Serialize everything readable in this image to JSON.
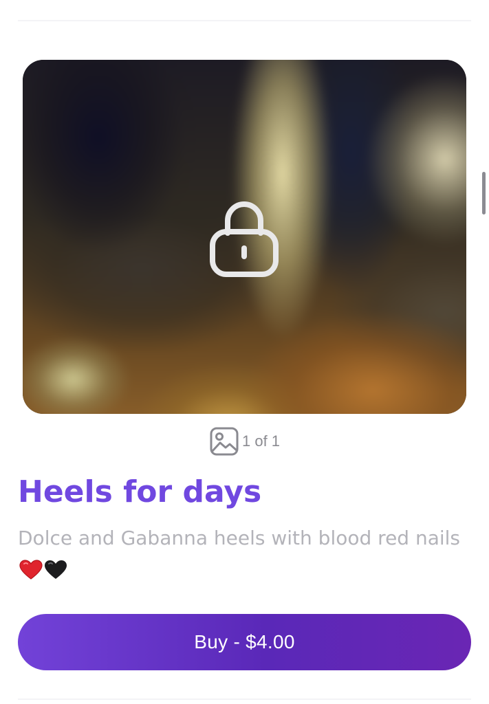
{
  "post": {
    "title": "Heels for days",
    "description": "Dolce and Gabanna heels with blood red nails",
    "emojis": [
      "red-heart-emoji",
      "black-heart-emoji"
    ],
    "media_counter": "1 of 1",
    "media_locked": true,
    "lock_icon": "lock-icon",
    "media_icon": "image-icon"
  },
  "buy": {
    "label": "Buy - $4.00"
  },
  "colors": {
    "title": "#7048e0",
    "description": "#b3b3b9",
    "button_start": "#7242d8",
    "button_end": "#6a26b4",
    "counter": "#8a8a90"
  }
}
